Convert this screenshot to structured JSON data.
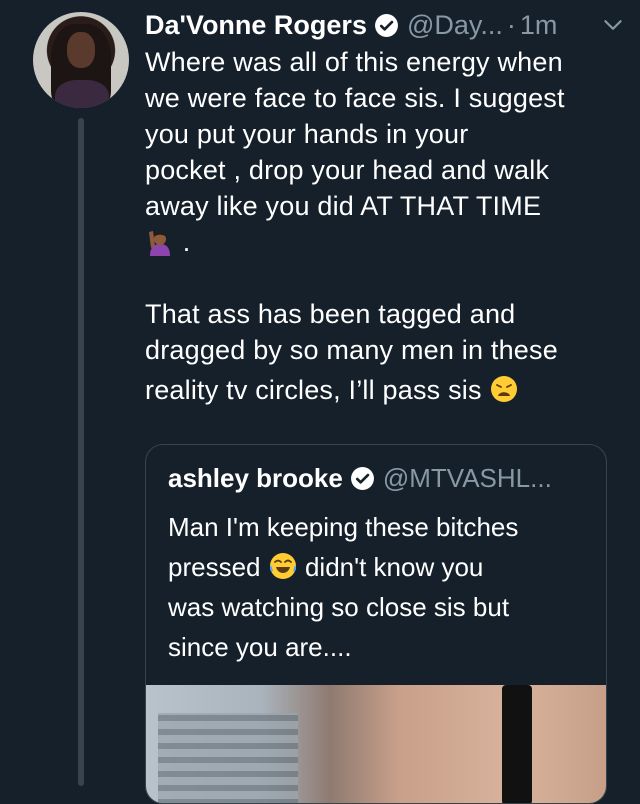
{
  "tweet": {
    "display_name": "Da'Vonne Rogers",
    "handle": "@Day...",
    "separator": "·",
    "time": "1m",
    "lines": [
      "Where was all of this energy when",
      "we were face to face sis. I suggest",
      "you put your hands in your",
      "pocket , drop your head and walk",
      "away like you did AT THAT TIME"
    ],
    "emoji_line_suffix": ".",
    "paragraph2": [
      "That ass has been tagged and",
      "dragged by so many men in these",
      "reality tv circles, I’ll pass sis"
    ]
  },
  "quoted": {
    "display_name": "ashley brooke",
    "handle": "@MTVASHL...",
    "line1": "Man I'm keeping these bitches",
    "line2_before": "pressed",
    "line2_after": "didn't know you",
    "line3": "was watching so close sis but",
    "line4": "since you are...."
  },
  "icons": {
    "verified": "verified-badge-icon",
    "caret": "chevron-down-icon",
    "emoji_raise_hand": "person-raising-hand-emoji",
    "emoji_weary": "weary-face-emoji",
    "emoji_laugh": "face-with-tears-of-joy-emoji"
  },
  "colors": {
    "background": "#15202b",
    "secondary_text": "#8899a6",
    "border": "#38444d"
  }
}
